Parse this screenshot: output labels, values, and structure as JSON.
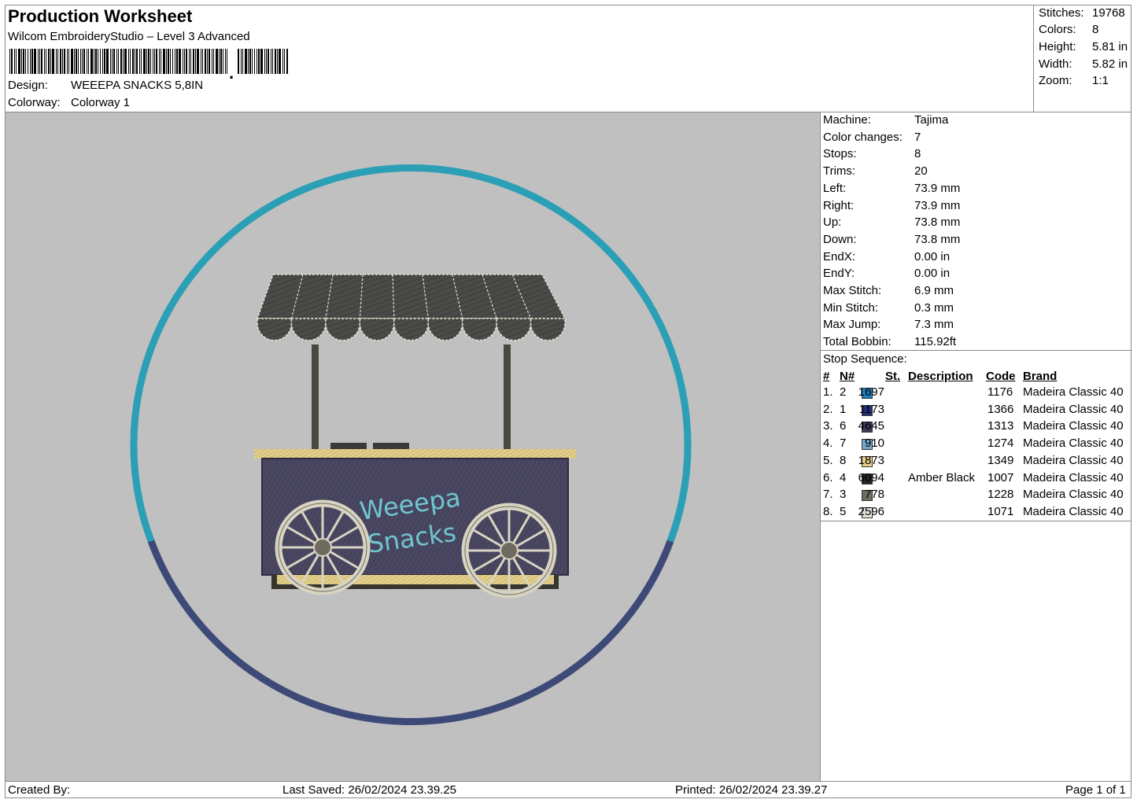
{
  "header": {
    "title": "Production Worksheet",
    "subtitle": "Wilcom EmbroideryStudio – Level 3 Advanced",
    "design_label": "Design:",
    "design_value": "WEEEPA SNACKS 5,8IN",
    "colorway_label": "Colorway:",
    "colorway_value": "Colorway 1"
  },
  "summary": {
    "stitches_label": "Stitches:",
    "stitches": "19768",
    "colors_label": "Colors:",
    "colors": "8",
    "height_label": "Height:",
    "height": "5.81 in",
    "width_label": "Width:",
    "width": "5.82 in",
    "zoom_label": "Zoom:",
    "zoom": "1:1"
  },
  "machine_info": [
    {
      "label": "Machine:",
      "value": "Tajima"
    },
    {
      "label": "Color changes:",
      "value": "7"
    },
    {
      "label": "Stops:",
      "value": "8"
    },
    {
      "label": "Trims:",
      "value": "20"
    },
    {
      "label": "Left:",
      "value": "73.9 mm"
    },
    {
      "label": "Right:",
      "value": "73.9 mm"
    },
    {
      "label": "Up:",
      "value": "73.8 mm"
    },
    {
      "label": "Down:",
      "value": "73.8 mm"
    },
    {
      "label": "EndX:",
      "value": "0.00 in"
    },
    {
      "label": "EndY:",
      "value": "0.00 in"
    },
    {
      "label": "Max Stitch:",
      "value": "6.9 mm"
    },
    {
      "label": "Min Stitch:",
      "value": "0.3 mm"
    },
    {
      "label": "Max Jump:",
      "value": "7.3 mm"
    },
    {
      "label": "Total Bobbin:",
      "value": "115.92ft"
    }
  ],
  "stop_sequence": {
    "label": "Stop Sequence:",
    "columns": {
      "index": "#",
      "needle": "N#",
      "stitches": "St.",
      "description": "Description",
      "code": "Code",
      "brand": "Brand"
    },
    "rows": [
      {
        "index": "1.",
        "needle": "2",
        "color": "#1a7fc0",
        "stitches": "1697",
        "description": "",
        "code": "1176",
        "brand": "Madeira Classic 40"
      },
      {
        "index": "2.",
        "needle": "1",
        "color": "#232f7a",
        "stitches": "1173",
        "description": "",
        "code": "1366",
        "brand": "Madeira Classic 40"
      },
      {
        "index": "3.",
        "needle": "6",
        "color": "#403a5c",
        "stitches": "4645",
        "description": "",
        "code": "1313",
        "brand": "Madeira Classic 40"
      },
      {
        "index": "4.",
        "needle": "7",
        "color": "#74a8c8",
        "stitches": "910",
        "description": "",
        "code": "1274",
        "brand": "Madeira Classic 40"
      },
      {
        "index": "5.",
        "needle": "8",
        "color": "#ecd08c",
        "stitches": "1873",
        "description": "",
        "code": "1349",
        "brand": "Madeira Classic 40"
      },
      {
        "index": "6.",
        "needle": "4",
        "color": "#262626",
        "stitches": "6094",
        "description": "Amber Black",
        "code": "1007",
        "brand": "Madeira Classic 40"
      },
      {
        "index": "7.",
        "needle": "3",
        "color": "#6e6a60",
        "stitches": "778",
        "description": "",
        "code": "1228",
        "brand": "Madeira Classic 40"
      },
      {
        "index": "8.",
        "needle": "5",
        "color": "#e6e4da",
        "stitches": "2596",
        "description": "",
        "code": "1071",
        "brand": "Madeira Classic 40"
      }
    ]
  },
  "design_preview": {
    "cart_text_line1": "Weeepa",
    "cart_text_line2": "Snacks",
    "ring_top_color": "#2a9fb5",
    "ring_bottom_color": "#3d4a78",
    "background_color": "#c0c0c0"
  },
  "footer": {
    "created_by": "Created By:",
    "last_saved": "Last Saved: 26/02/2024 23.39.25",
    "printed": "Printed: 26/02/2024 23.39.27",
    "page": "Page 1 of 1"
  }
}
